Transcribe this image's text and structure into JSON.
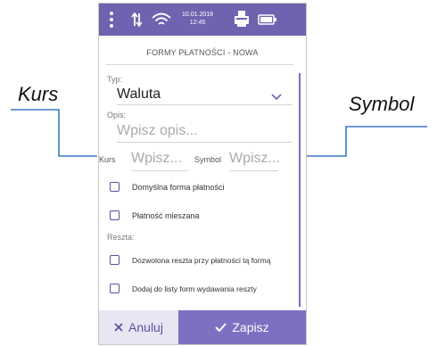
{
  "callouts": {
    "kurs": "Kurs",
    "symbol": "Symbol"
  },
  "statusbar": {
    "date": "10.01.2018",
    "time": "12:45"
  },
  "form": {
    "title": "FORMY PŁATNOŚCI - NOWA",
    "typ_label": "Typ:",
    "typ_value": "Waluta",
    "opis_label": "Opis:",
    "opis_placeholder": "Wpisz opis...",
    "kurs_label": "Kurs",
    "kurs_placeholder": "Wpisz...",
    "symbol_label": "Symbol",
    "symbol_placeholder": "Wpisz...",
    "checkbox_default": "Domyślna forma płatności",
    "checkbox_mixed": "Płatność mieszana",
    "reszta_label": "Reszta:",
    "checkbox_change_allowed": "Dozwolona reszta przy płatności tą formą",
    "checkbox_change_list": "Dodaj do listy form wydawania reszty"
  },
  "footer": {
    "cancel_label": "Anuluj",
    "save_label": "Zapisz"
  },
  "colors": {
    "accent": "#6f63b0",
    "accent_light": "#7d70c2",
    "callout_line": "#3b78c3"
  },
  "icons": [
    "menu-icon",
    "data-transfer-icon",
    "wifi-icon",
    "printer-icon",
    "battery-icon",
    "chevron-down-icon",
    "close-icon",
    "check-icon"
  ]
}
